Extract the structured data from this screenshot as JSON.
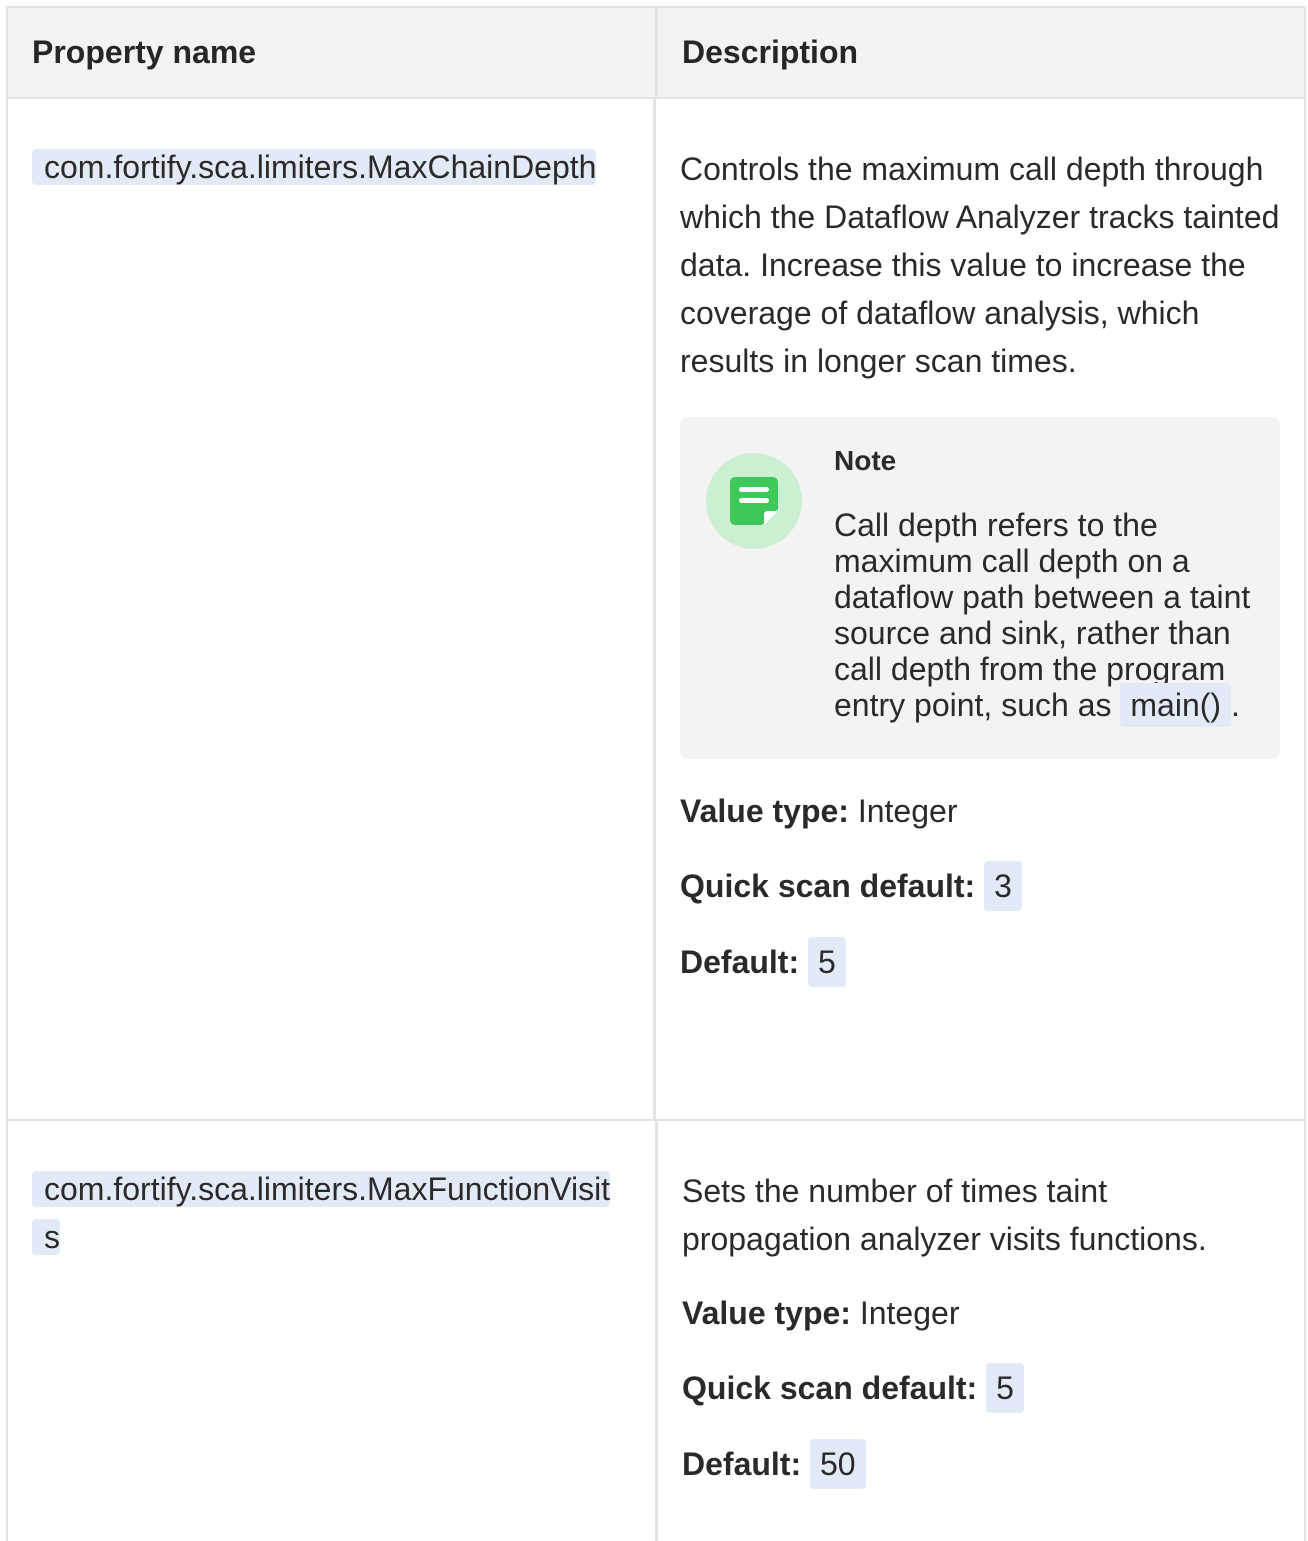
{
  "table": {
    "headers": {
      "property_name": "Property name",
      "description": "Description"
    },
    "rows": [
      {
        "property": "com.fortify.sca.limiters.MaxChainDepth",
        "description": "Controls the maximum call depth through which the Dataflow Analyzer tracks tainted data. Increase this value to increase the coverage of dataflow analysis, which results in longer scan times.",
        "note": {
          "title": "Note",
          "text_before": "Call depth refers to the maximum call depth on a dataflow path between a taint source and sink, rather than call depth from the program entry point, such as ",
          "code": "main()",
          "text_after": "."
        },
        "value_type_label": "Value type:",
        "value_type": "Integer",
        "quick_scan_label": "Quick scan default:",
        "quick_scan_default": "3",
        "default_label": "Default:",
        "default": "5"
      },
      {
        "property": "com.fortify.sca.limiters.MaxFunctionVisits",
        "description": "Sets the number of times taint propagation analyzer visits functions.",
        "value_type_label": "Value type:",
        "value_type": "Integer",
        "quick_scan_label": "Quick scan default:",
        "quick_scan_default": "5",
        "default_label": "Default:",
        "default": "50"
      }
    ]
  },
  "colors": {
    "note_icon": "#3cc95a",
    "note_icon_bg": "#ccefd3",
    "code_bg": "#e3eaf7"
  },
  "icons": {
    "note": "note-icon"
  }
}
